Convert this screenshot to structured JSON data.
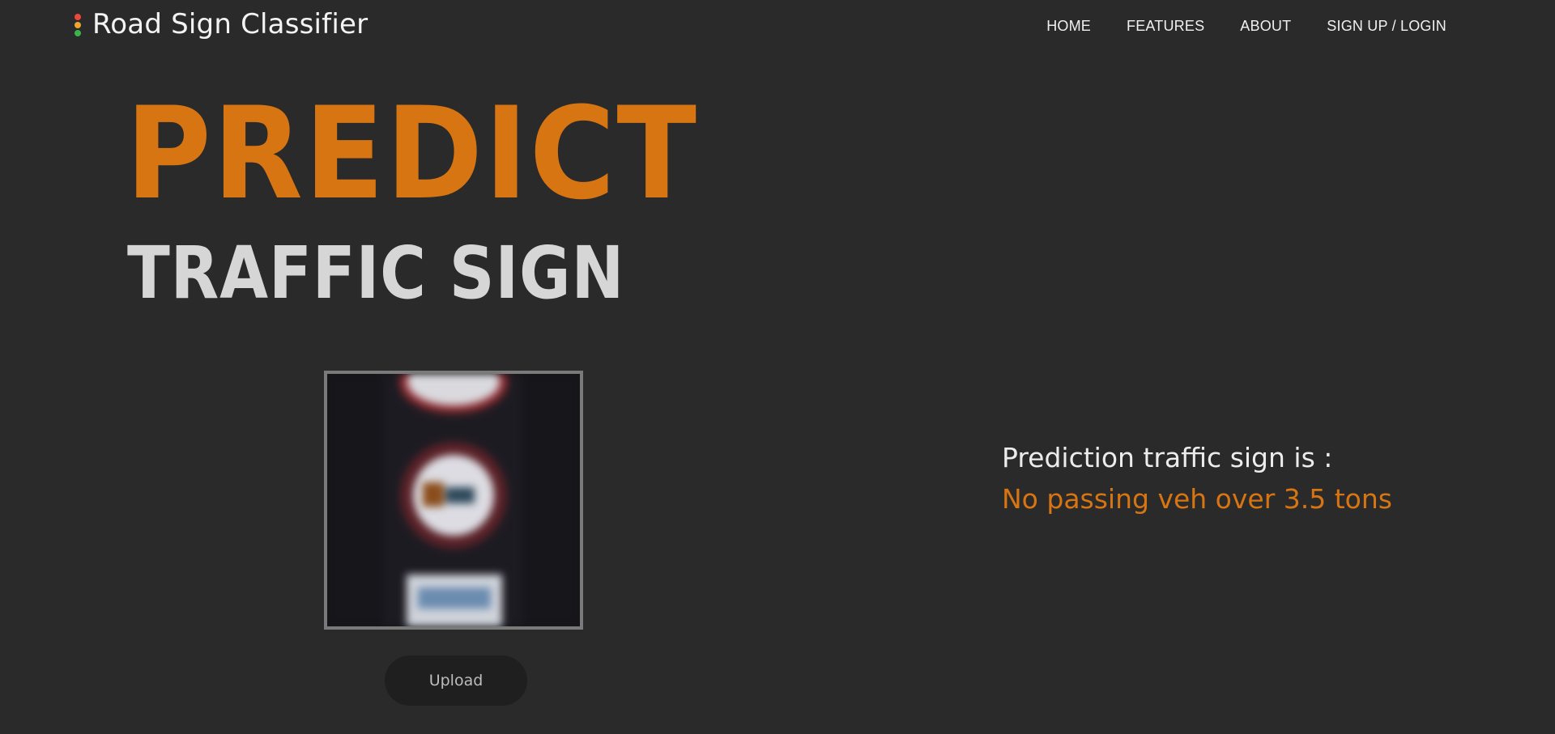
{
  "header": {
    "logo_icon": "traffic-light-icon",
    "title": "Road Sign Classifier",
    "nav": [
      {
        "label": "HOME"
      },
      {
        "label": "FEATURES"
      },
      {
        "label": "ABOUT"
      },
      {
        "label": "SIGN UP / LOGIN"
      }
    ]
  },
  "hero": {
    "line1": "PREDICT",
    "line2": "TRAFFIC SIGN"
  },
  "upload": {
    "button_label": "Upload"
  },
  "result": {
    "label": "Prediction traffic sign is :",
    "value": "No passing veh over 3.5 tons"
  },
  "colors": {
    "background": "#2a2a2a",
    "accent": "#d87513",
    "text_light": "#d6d6d6"
  }
}
